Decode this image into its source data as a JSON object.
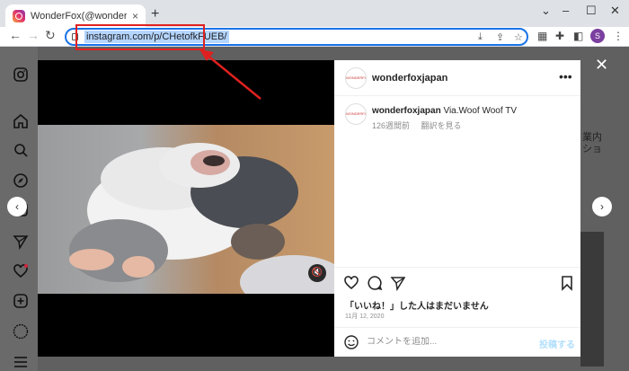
{
  "browser": {
    "tab_title": "WonderFox(@wonderfoxjapan) •",
    "tab_close": "×",
    "new_tab": "+",
    "window_controls": [
      "⌄",
      "–",
      "☐",
      "✕"
    ],
    "url": "instagram.com/p/CHetofkFUEB/",
    "profile_initial": "S"
  },
  "post": {
    "username": "wonderfoxjapan",
    "caption_user": "wonderfoxjapan",
    "caption_text": "Via.Woof Woof TV",
    "time_ago": "126週間前",
    "translate": "翻訳を見る",
    "likes_text": "「いいね！」した人はまだいません",
    "date": "11月 12, 2020",
    "comment_placeholder": "コメントを追加...",
    "post_button": "投稿する",
    "more": "•••"
  },
  "background": {
    "partial_text_1": "業内",
    "partial_text_2": "ショ"
  },
  "icons": {
    "prev": "‹",
    "next": "›",
    "close": "✕"
  },
  "colors": {
    "accent": "#1a73e8",
    "annotation": "#e02020"
  }
}
